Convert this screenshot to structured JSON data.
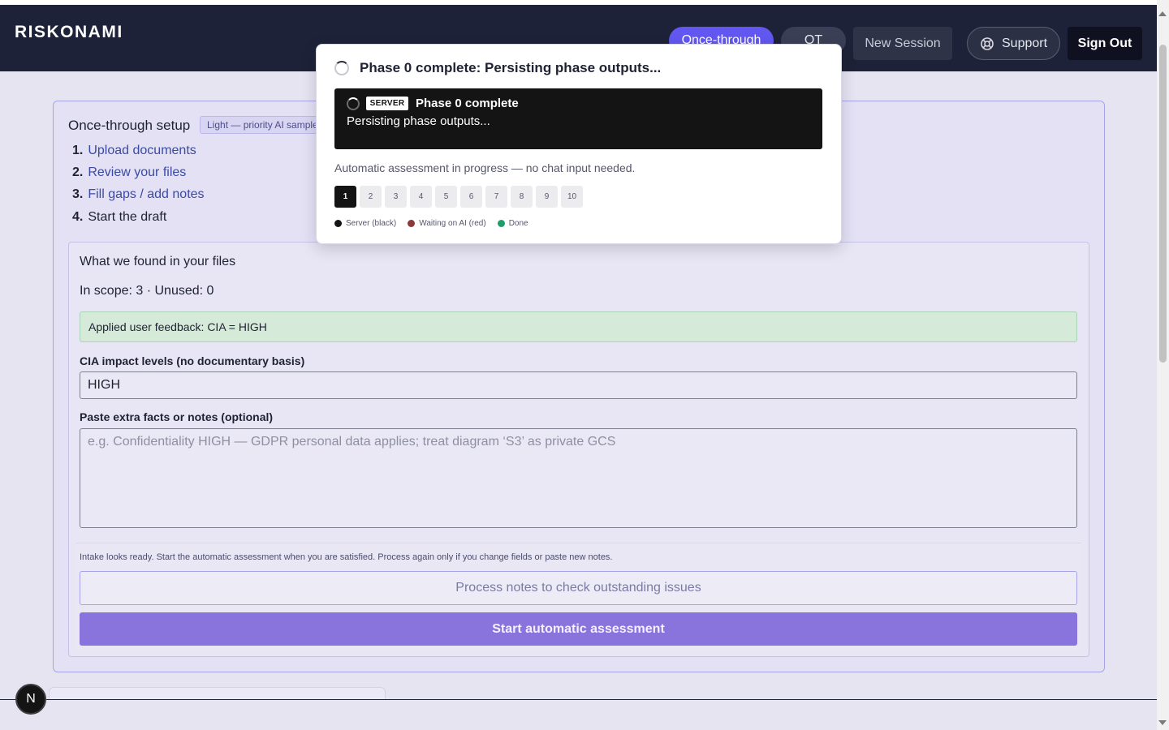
{
  "header": {
    "brand": "RISKONAMI",
    "nav": {
      "once_through": "Once-through",
      "ot_test": "OT test",
      "new_session": "New Session",
      "support": "Support",
      "sign_out": "Sign Out"
    }
  },
  "setup": {
    "title": "Once-through setup",
    "badge": "Light — priority AI sample",
    "steps": [
      {
        "num": "1.",
        "label": "Upload documents"
      },
      {
        "num": "2.",
        "label": "Review your files"
      },
      {
        "num": "3.",
        "label": "Fill gaps / add notes"
      },
      {
        "num": "4.",
        "label": "Start the draft"
      }
    ]
  },
  "found": {
    "title": "What we found in your files",
    "scope": "In scope: 3 · Unused: 0",
    "feedback": "Applied user feedback: CIA = HIGH",
    "cia_label": "CIA impact levels (no documentary basis)",
    "cia_value": "HIGH",
    "notes_label": "Paste extra facts or notes (optional)",
    "notes_placeholder": "e.g. Confidentiality HIGH — GDPR personal data applies; treat diagram ‘S3’ as private GCS",
    "ready_text": "Intake looks ready. Start the automatic assessment when you are satisfied. Process again only if you change fields or paste new notes.",
    "process_button": "Process notes to check outstanding issues",
    "start_button": "Start automatic assessment"
  },
  "popup": {
    "title": "Phase 0 complete: Persisting phase outputs...",
    "server_tag": "SERVER",
    "server_head": "Phase 0 complete",
    "server_sub": "Persisting phase outputs...",
    "auto_text": "Automatic assessment in progress — no chat input needed.",
    "phases": [
      "1",
      "2",
      "3",
      "4",
      "5",
      "6",
      "7",
      "8",
      "9",
      "10"
    ],
    "active_phase": "1",
    "legend": [
      {
        "label": "Server (black)",
        "color": "#141414"
      },
      {
        "label": "Waiting on AI (red)",
        "color": "#8b3a3a"
      },
      {
        "label": "Done",
        "color": "#1f9d6b"
      }
    ]
  },
  "next_badge": "N",
  "colors": {
    "header_bg": "#1e2238",
    "accent": "#6257f0",
    "start_button": "#8874dc",
    "feedback_bg": "#d6ead9"
  }
}
